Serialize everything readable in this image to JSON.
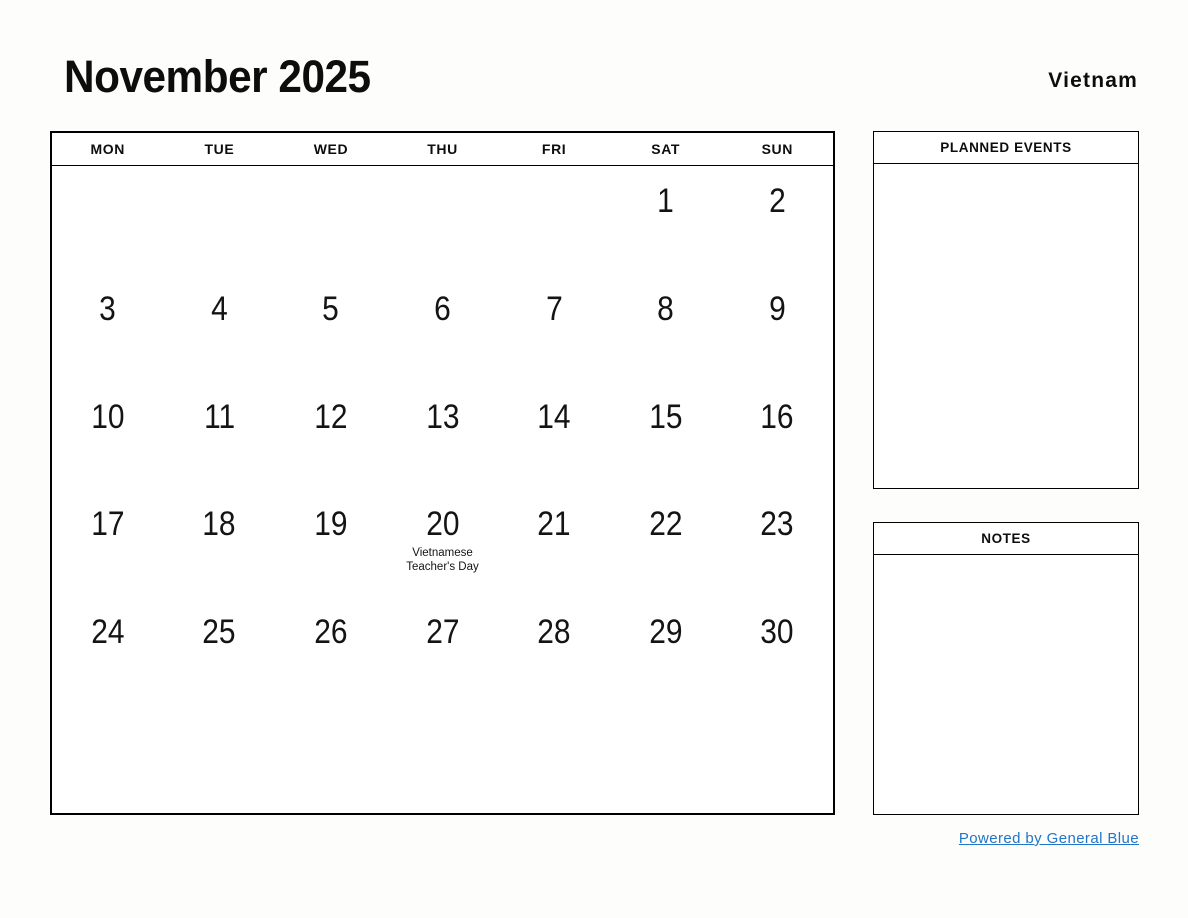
{
  "header": {
    "month_title": "November 2025",
    "country": "Vietnam"
  },
  "calendar": {
    "weekdays": [
      "MON",
      "TUE",
      "WED",
      "THU",
      "FRI",
      "SAT",
      "SUN"
    ],
    "weeks": [
      [
        {
          "day": "",
          "event": ""
        },
        {
          "day": "",
          "event": ""
        },
        {
          "day": "",
          "event": ""
        },
        {
          "day": "",
          "event": ""
        },
        {
          "day": "",
          "event": ""
        },
        {
          "day": "1",
          "event": ""
        },
        {
          "day": "2",
          "event": ""
        }
      ],
      [
        {
          "day": "3",
          "event": ""
        },
        {
          "day": "4",
          "event": ""
        },
        {
          "day": "5",
          "event": ""
        },
        {
          "day": "6",
          "event": ""
        },
        {
          "day": "7",
          "event": ""
        },
        {
          "day": "8",
          "event": ""
        },
        {
          "day": "9",
          "event": ""
        }
      ],
      [
        {
          "day": "10",
          "event": ""
        },
        {
          "day": "11",
          "event": ""
        },
        {
          "day": "12",
          "event": ""
        },
        {
          "day": "13",
          "event": ""
        },
        {
          "day": "14",
          "event": ""
        },
        {
          "day": "15",
          "event": ""
        },
        {
          "day": "16",
          "event": ""
        }
      ],
      [
        {
          "day": "17",
          "event": ""
        },
        {
          "day": "18",
          "event": ""
        },
        {
          "day": "19",
          "event": ""
        },
        {
          "day": "20",
          "event": "Vietnamese Teacher's Day"
        },
        {
          "day": "21",
          "event": ""
        },
        {
          "day": "22",
          "event": ""
        },
        {
          "day": "23",
          "event": ""
        }
      ],
      [
        {
          "day": "24",
          "event": ""
        },
        {
          "day": "25",
          "event": ""
        },
        {
          "day": "26",
          "event": ""
        },
        {
          "day": "27",
          "event": ""
        },
        {
          "day": "28",
          "event": ""
        },
        {
          "day": "29",
          "event": ""
        },
        {
          "day": "30",
          "event": ""
        }
      ],
      [
        {
          "day": "",
          "event": ""
        },
        {
          "day": "",
          "event": ""
        },
        {
          "day": "",
          "event": ""
        },
        {
          "day": "",
          "event": ""
        },
        {
          "day": "",
          "event": ""
        },
        {
          "day": "",
          "event": ""
        },
        {
          "day": "",
          "event": ""
        }
      ]
    ]
  },
  "panels": {
    "planned_events_title": "PLANNED EVENTS",
    "planned_events_content": "",
    "notes_title": "NOTES",
    "notes_content": ""
  },
  "footer": {
    "link_label": "Powered by General Blue"
  },
  "colors": {
    "link": "#2176c7",
    "border": "#000000",
    "text": "#111111",
    "page_background": "#fdfdfc"
  }
}
